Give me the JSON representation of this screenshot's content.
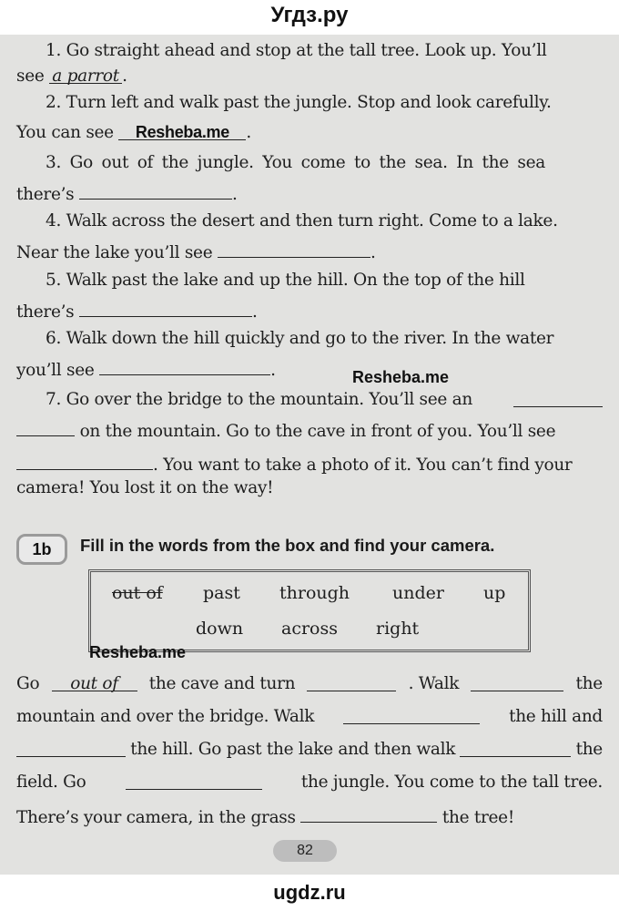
{
  "header": {
    "site": "Угдз.ру"
  },
  "footer": {
    "site": "ugdz.ru"
  },
  "watermark": "Resheba.me",
  "exercise_1a": {
    "lines": [
      "1. Go straight ahead and stop at the tall tree. Look up. You’ll",
      "see",
      "a parrot",
      ".",
      "2. Turn left and walk past the jungle. Stop and look carefully.",
      "You can see",
      ".",
      "3. Go out of the jungle. You come to the sea. In the sea",
      "there’s",
      ".",
      "4. Walk across the desert and then turn right. Come to a lake.",
      "Near the lake you’ll see",
      ".",
      "5. Walk past the lake and up the hill. On the top of the hill",
      "there’s",
      ".",
      "6. Walk down the hill quickly and go to the river. In the water",
      "you’ll see",
      ".",
      "7. Go over the bridge to the mountain. You’ll see an",
      "on the mountain. Go to the cave in front of you. You’ll see",
      ". You want to take a photo of it. You can’t find your",
      "camera! You lost it on the way!"
    ]
  },
  "exercise_1b": {
    "badge": "1b",
    "instruction": "Fill in the words from the box and find your camera.",
    "box_words": [
      "out of",
      "past",
      "through",
      "under",
      "up",
      "down",
      "across",
      "right"
    ],
    "text": [
      "Go",
      "out of",
      "the cave and turn",
      ". Walk",
      "the",
      "mountain and over the bridge. Walk",
      "the hill and",
      "the hill. Go past the lake and then walk",
      "the",
      "field. Go",
      "the jungle. You come to the tall tree.",
      "There’s your camera, in the grass",
      "the tree!"
    ]
  },
  "page_number": "82"
}
